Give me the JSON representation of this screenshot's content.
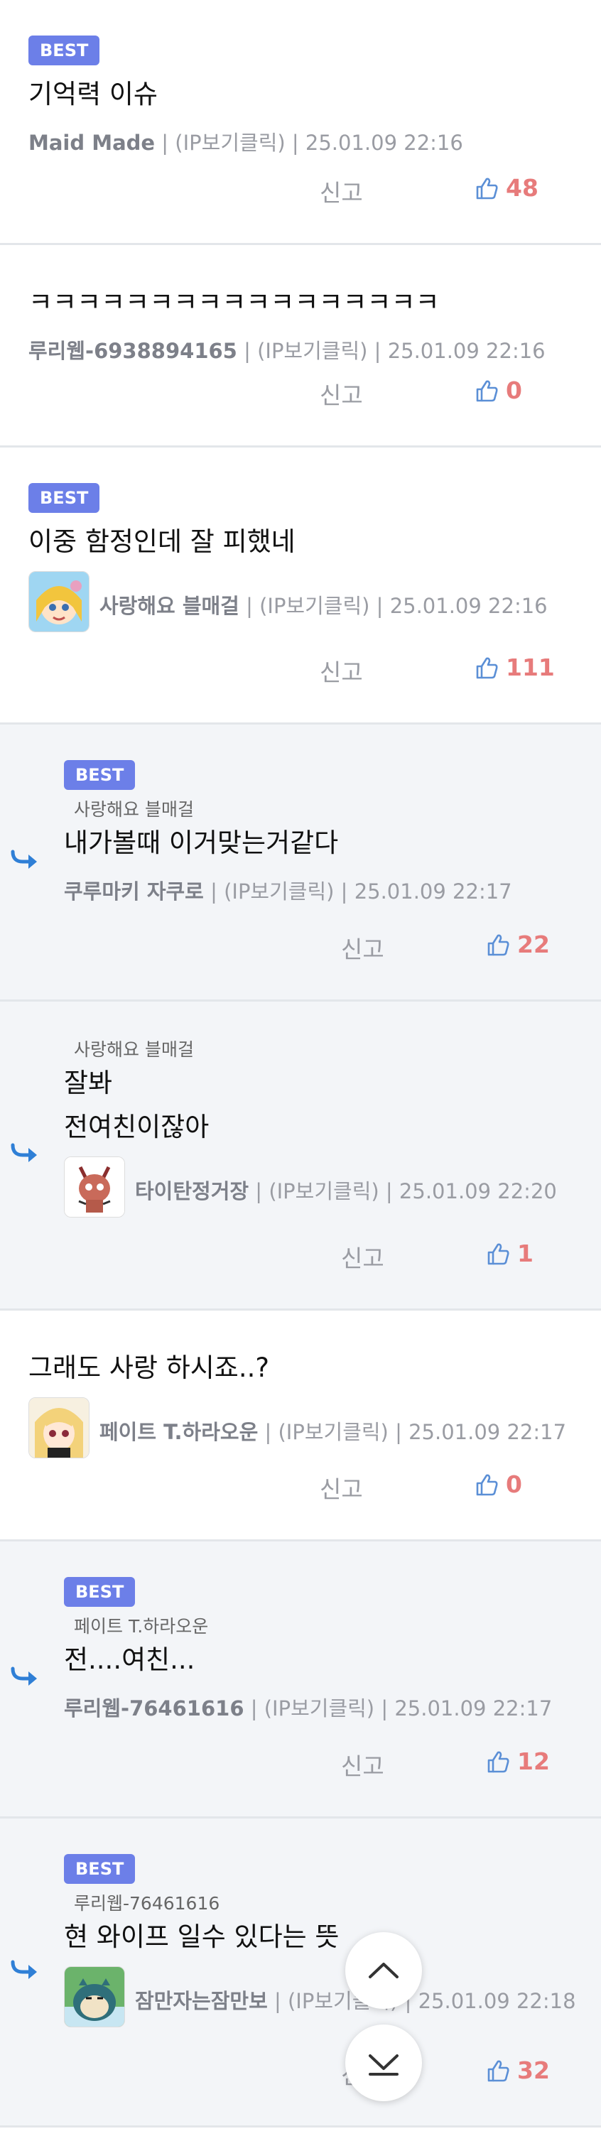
{
  "ui": {
    "report_label": "신고",
    "best_label": "BEST",
    "ip_label": "(IP보기클릭)",
    "colors": {
      "best_badge": "#6c7fe8",
      "like_count": "#e77b7b",
      "reply_bg": "#f3f5f8",
      "reply_arrow": "#2f7fd6"
    }
  },
  "comments": [
    {
      "best": true,
      "reply": false,
      "parent": "",
      "lines": [
        "기억력 이슈"
      ],
      "author": "Maid Made",
      "avatar": "",
      "time": "25.01.09 22:16",
      "likes": "48"
    },
    {
      "best": false,
      "reply": false,
      "parent": "",
      "lines": [
        "ㅋㅋㅋㅋㅋㅋㅋㅋㅋㅋㅋㅋㅋㅋㅋㅋㅋ"
      ],
      "author": "루리웹-6938894165",
      "avatar": "",
      "time": "25.01.09 22:16",
      "likes": "0"
    },
    {
      "best": true,
      "reply": false,
      "parent": "",
      "lines": [
        "이중 함정인데 잘 피했네"
      ],
      "author": "사랑해요 블매걸",
      "avatar": "blonde-girl-avatar",
      "time": "25.01.09 22:16",
      "likes": "111"
    },
    {
      "best": true,
      "reply": true,
      "parent": "사랑해요 블매걸",
      "lines": [
        "내가볼때 이거맞는거같다"
      ],
      "author": "쿠루마키 자쿠로",
      "avatar": "",
      "time": "25.01.09 22:17",
      "likes": "22"
    },
    {
      "best": false,
      "reply": true,
      "parent": "사랑해요 블매걸",
      "lines": [
        "잘봐",
        "전여친이잖아"
      ],
      "author": "타이탄정거장",
      "avatar": "robot-avatar",
      "time": "25.01.09 22:20",
      "likes": "1"
    },
    {
      "best": false,
      "reply": false,
      "parent": "",
      "lines": [
        "그래도 사랑 하시죠..?"
      ],
      "author": "페이트 T.하라오운",
      "avatar": "anime-girl-avatar",
      "time": "25.01.09 22:17",
      "likes": "0"
    },
    {
      "best": true,
      "reply": true,
      "parent": "페이트 T.하라오운",
      "lines": [
        "전....여친..."
      ],
      "author": "루리웹-76461616",
      "avatar": "",
      "time": "25.01.09 22:17",
      "likes": "12"
    },
    {
      "best": true,
      "reply": true,
      "parent": "루리웹-76461616",
      "lines": [
        "현 와이프 일수 있다는 뜻"
      ],
      "author": "잠만자는잠만보",
      "avatar": "snorlax-avatar",
      "time": "25.01.09 22:18",
      "likes": "32"
    }
  ]
}
